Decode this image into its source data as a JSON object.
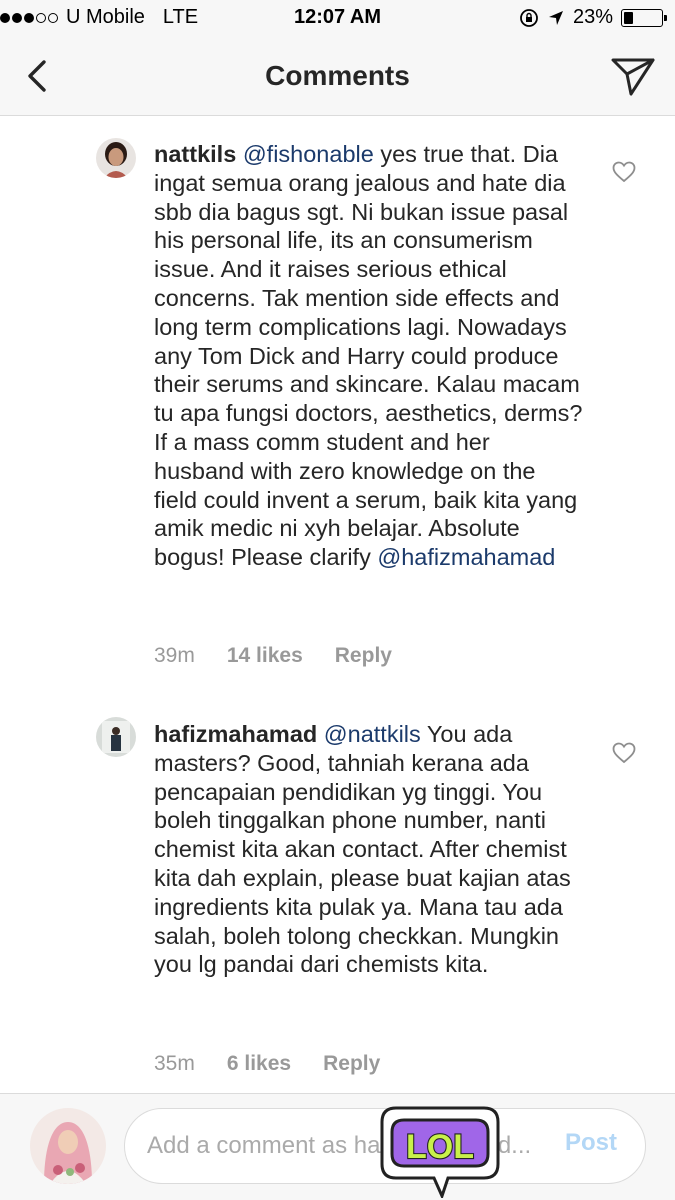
{
  "status_bar": {
    "carrier": "U Mobile",
    "network": "LTE",
    "time": "12:07 AM",
    "battery": "23%",
    "battery_level": 0.23,
    "signal_bars_filled": 3,
    "signal_bars_total": 5
  },
  "nav": {
    "title": "Comments",
    "back_icon": "chevron-left-icon",
    "send_icon": "paper-plane-icon"
  },
  "comments": [
    {
      "username": "nattkils",
      "mention": "@fishonable",
      "body": " yes true that. Dia ingat semua orang jealous and hate dia sbb dia bagus sgt. Ni bukan issue pasal his personal life, its an consumerism issue. And it raises serious ethical concerns. Tak mention side effects and long term complications lagi. Nowadays any Tom Dick and Harry could produce their serums and skincare. Kalau macam tu apa fungsi doctors, aesthetics, derms? If a mass comm student and her husband with zero knowledge on the field could invent a serum, baik kita yang amik medic ni xyh belajar. Absolute bogus! Please clarify ",
      "trailing_mention": "@hafizmahamad",
      "time": "39m",
      "likes": "14 likes",
      "reply": "Reply"
    },
    {
      "username": "hafizmahamad",
      "mention": "@nattkils",
      "body": " You ada masters? Good, tahniah kerana ada pencapaian pendidikan yg tinggi. You boleh tinggalkan phone number, nanti chemist kita akan contact. After chemist kita dah explain, please buat kajian atas ingredients kita pulak ya. Mana tau ada salah, boleh tolong checkkan. Mungkin you lg pandai dari chemists kita.",
      "trailing_mention": "",
      "time": "35m",
      "likes": "6 likes",
      "reply": "Reply"
    }
  ],
  "composer": {
    "placeholder": "Add a comment as hafizmahamad...",
    "post_label": "Post"
  },
  "sticker": {
    "text": "LOL"
  },
  "colors": {
    "mention": "#1b3a6b",
    "meta_gray": "#999999",
    "post_disabled": "#b3d7f6",
    "sticker_purple": "#a066e8"
  }
}
